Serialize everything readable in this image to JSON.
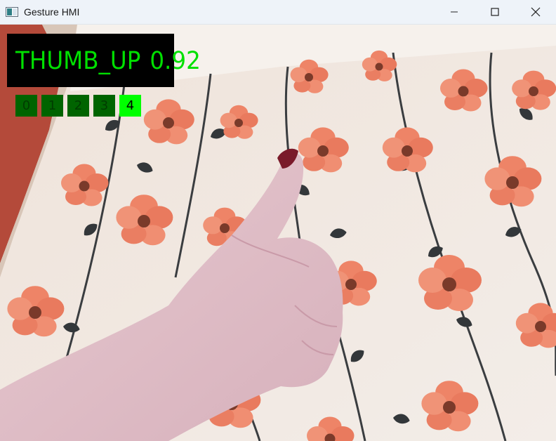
{
  "window": {
    "title": "Gesture HMI",
    "controls": [
      "minimize-icon",
      "maximize-icon",
      "close-icon"
    ]
  },
  "overlay": {
    "gesture_name": "THUMB_UP",
    "confidence": "0.92",
    "indices": [
      "0",
      "1",
      "2",
      "3",
      "4"
    ],
    "active_index": 4,
    "colors": {
      "text": "#00e000",
      "box": "#000000",
      "cell": "#006400",
      "cell_active": "#00ff00"
    }
  }
}
